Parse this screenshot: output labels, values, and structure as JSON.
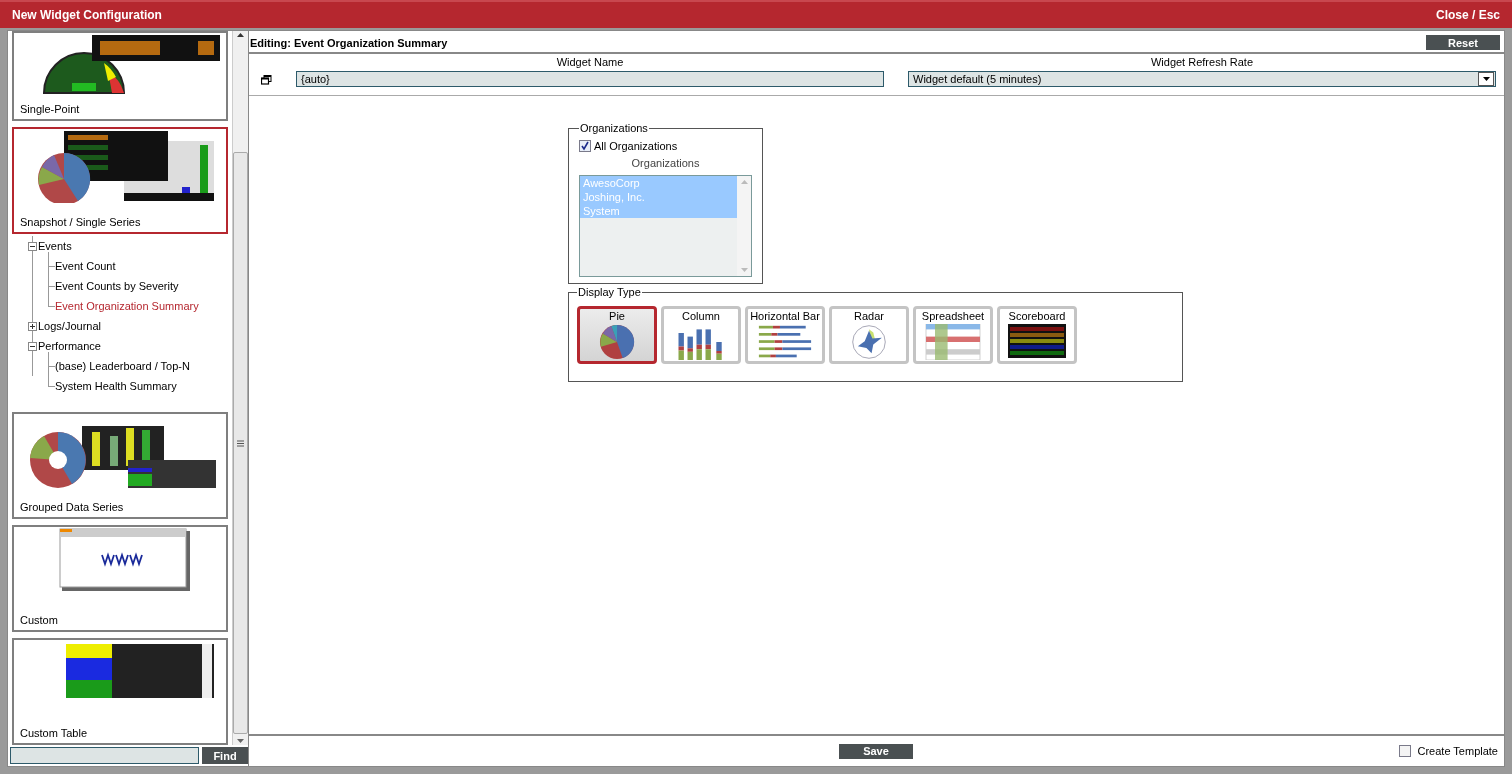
{
  "window": {
    "title": "New Widget Configuration",
    "close": "Close / Esc"
  },
  "sidebar": {
    "cards": [
      {
        "label": "Single-Point",
        "kind": "gauge",
        "selected": false
      },
      {
        "label": "Snapshot / Single Series",
        "kind": "snapshot",
        "selected": true,
        "children": [
          {
            "label": "Events",
            "expanded": true,
            "children": [
              {
                "label": "Event Count",
                "selected": false
              },
              {
                "label": "Event Counts by Severity",
                "selected": false
              },
              {
                "label": "Event Organization Summary",
                "selected": true
              }
            ]
          },
          {
            "label": "Logs/Journal",
            "expanded": false
          },
          {
            "label": "Performance",
            "expanded": true,
            "children": [
              {
                "label": "(base) Leaderboard / Top-N",
                "selected": false
              },
              {
                "label": "System Health Summary",
                "selected": false
              }
            ]
          }
        ]
      },
      {
        "label": "Grouped Data Series",
        "kind": "grouped",
        "selected": false
      },
      {
        "label": "Custom",
        "kind": "browser",
        "selected": false
      },
      {
        "label": "Custom Table",
        "kind": "table",
        "selected": false
      }
    ],
    "find_button": "Find"
  },
  "editor": {
    "heading": "Editing: Event Organization Summary",
    "reset_button": "Reset",
    "widget_name": {
      "label": "Widget Name",
      "value": "{auto}"
    },
    "refresh_rate": {
      "label": "Widget Refresh Rate",
      "value": "Widget default (5 minutes)"
    },
    "organizations": {
      "legend": "Organizations",
      "all_checkbox": {
        "label": "All Organizations",
        "checked": true
      },
      "list_label": "Organizations",
      "items": [
        {
          "label": "AwesoCorp",
          "selected": true
        },
        {
          "label": "Joshing, Inc.",
          "selected": true
        },
        {
          "label": "System",
          "selected": true
        }
      ]
    },
    "display_type": {
      "legend": "Display Type",
      "options": [
        {
          "label": "Pie",
          "kind": "pie",
          "selected": true
        },
        {
          "label": "Column",
          "kind": "column",
          "selected": false
        },
        {
          "label": "Horizontal Bar",
          "kind": "hbar",
          "selected": false
        },
        {
          "label": "Radar",
          "kind": "radar",
          "selected": false
        },
        {
          "label": "Spreadsheet",
          "kind": "spreadsheet",
          "selected": false
        },
        {
          "label": "Scoreboard",
          "kind": "scoreboard",
          "selected": false
        }
      ]
    },
    "save_button": "Save",
    "create_template": {
      "label": "Create Template",
      "checked": false
    }
  }
}
